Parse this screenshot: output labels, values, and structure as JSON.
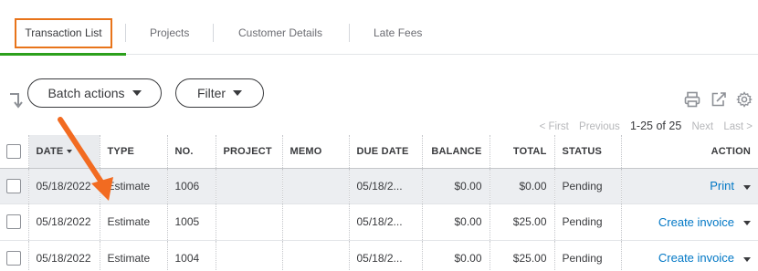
{
  "tabs": [
    {
      "label": "Transaction List",
      "active": true
    },
    {
      "label": "Projects",
      "active": false
    },
    {
      "label": "Customer Details",
      "active": false
    },
    {
      "label": "Late Fees",
      "active": false
    }
  ],
  "toolbar": {
    "batch_actions_label": "Batch actions",
    "filter_label": "Filter",
    "icons": [
      "sort-arrow-icon",
      "print-icon",
      "export-icon",
      "gear-icon"
    ]
  },
  "pagination": {
    "first": "< First",
    "previous": "Previous",
    "range": "1-25 of 25",
    "next": "Next",
    "last": "Last >"
  },
  "table": {
    "columns": [
      "DATE",
      "TYPE",
      "NO.",
      "PROJECT",
      "MEMO",
      "DUE DATE",
      "BALANCE",
      "TOTAL",
      "STATUS",
      "ACTION"
    ],
    "sorted_column": "DATE",
    "rows": [
      {
        "date": "05/18/2022",
        "type": "Estimate",
        "no": "1006",
        "project": "",
        "memo": "",
        "due_date": "05/18/2...",
        "balance": "$0.00",
        "total": "$0.00",
        "status": "Pending",
        "action": "Print"
      },
      {
        "date": "05/18/2022",
        "type": "Estimate",
        "no": "1005",
        "project": "",
        "memo": "",
        "due_date": "05/18/2...",
        "balance": "$0.00",
        "total": "$25.00",
        "status": "Pending",
        "action": "Create invoice"
      },
      {
        "date": "05/18/2022",
        "type": "Estimate",
        "no": "1004",
        "project": "",
        "memo": "",
        "due_date": "05/18/2...",
        "balance": "$0.00",
        "total": "$25.00",
        "status": "Pending",
        "action": "Create invoice"
      }
    ]
  },
  "colors": {
    "active_tab_outline": "#e8741a",
    "active_tab_underline": "#2ca01c",
    "link": "#0077c5",
    "annotation_arrow": "#f26b21"
  }
}
